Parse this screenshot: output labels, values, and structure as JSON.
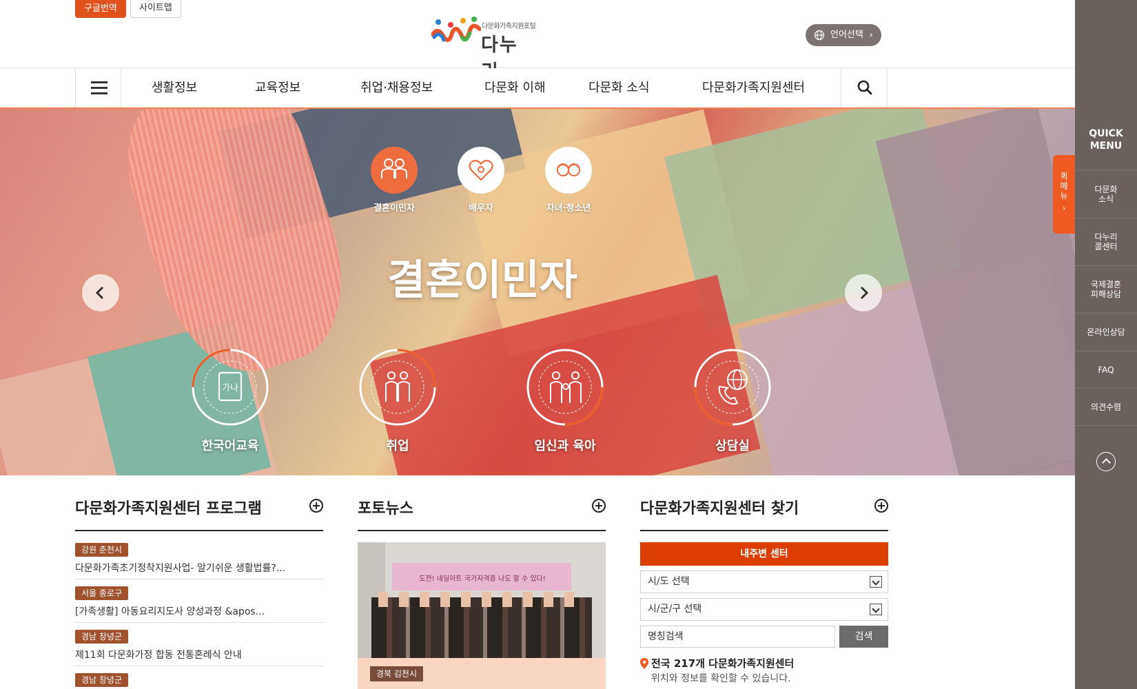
{
  "top": {
    "google_translate": "구글번역",
    "sitemap": "사이트맵",
    "logo_tagline": "다문화가족지원포털",
    "logo_name": "다누리",
    "language": "언어선택"
  },
  "nav": {
    "items": [
      "생활정보",
      "교육정보",
      "취업·채용정보",
      "다문화 이해",
      "다문화 소식",
      "다문화가족지원센터"
    ]
  },
  "hero": {
    "categories": [
      "결혼이민자",
      "배우자",
      "자녀·청소년"
    ],
    "active_category": "결혼이민자",
    "title": "결혼이민자",
    "services": [
      "한국어교육",
      "취업",
      "임신과 육아",
      "상담실"
    ]
  },
  "program": {
    "heading": "다문화가족지원센터 프로그램",
    "items": [
      {
        "region": "강원 춘천시",
        "title": "다문화가족초기정착지원사업- 알기쉬운 생활법률?..."
      },
      {
        "region": "서울 종로구",
        "title": "[가족생활] 아동요리지도사 양성과정 &apos..."
      },
      {
        "region": "경남 창녕군",
        "title": "제11회 다문화가정 합동 전통혼례식 안내"
      },
      {
        "region": "경남 창녕군",
        "title": ""
      }
    ]
  },
  "photonews": {
    "heading": "포토뉴스",
    "region": "경북 김천시",
    "banner_text": "도전! 네일아트 국가자격증 나도 할 수 있다!",
    "title": ""
  },
  "find_center": {
    "heading": "다문화가족지원센터 찾기",
    "nearby": "내주변 센터",
    "province_select": "시/도 선택",
    "district_select": "시/군/구 선택",
    "name_search": "명칭검색",
    "search_button": "검색",
    "count_text": "전국 217개 다문화가족지원센터",
    "description": "위치와 정보를 확인할 수 있습니다."
  },
  "quick_menu": {
    "title_line1": "QUICK",
    "title_line2": "MENU",
    "tab_text": "퀵메뉴",
    "items": [
      "다문화 소식",
      "다누리 콜센터",
      "국제결혼 피해상담",
      "온라인상담",
      "FAQ",
      "의견수렴"
    ]
  },
  "colors": {
    "accent": "#ef5a22",
    "quick_bg": "#6a605c",
    "near_btn": "#dc3e00",
    "badge": "#a0522d"
  }
}
